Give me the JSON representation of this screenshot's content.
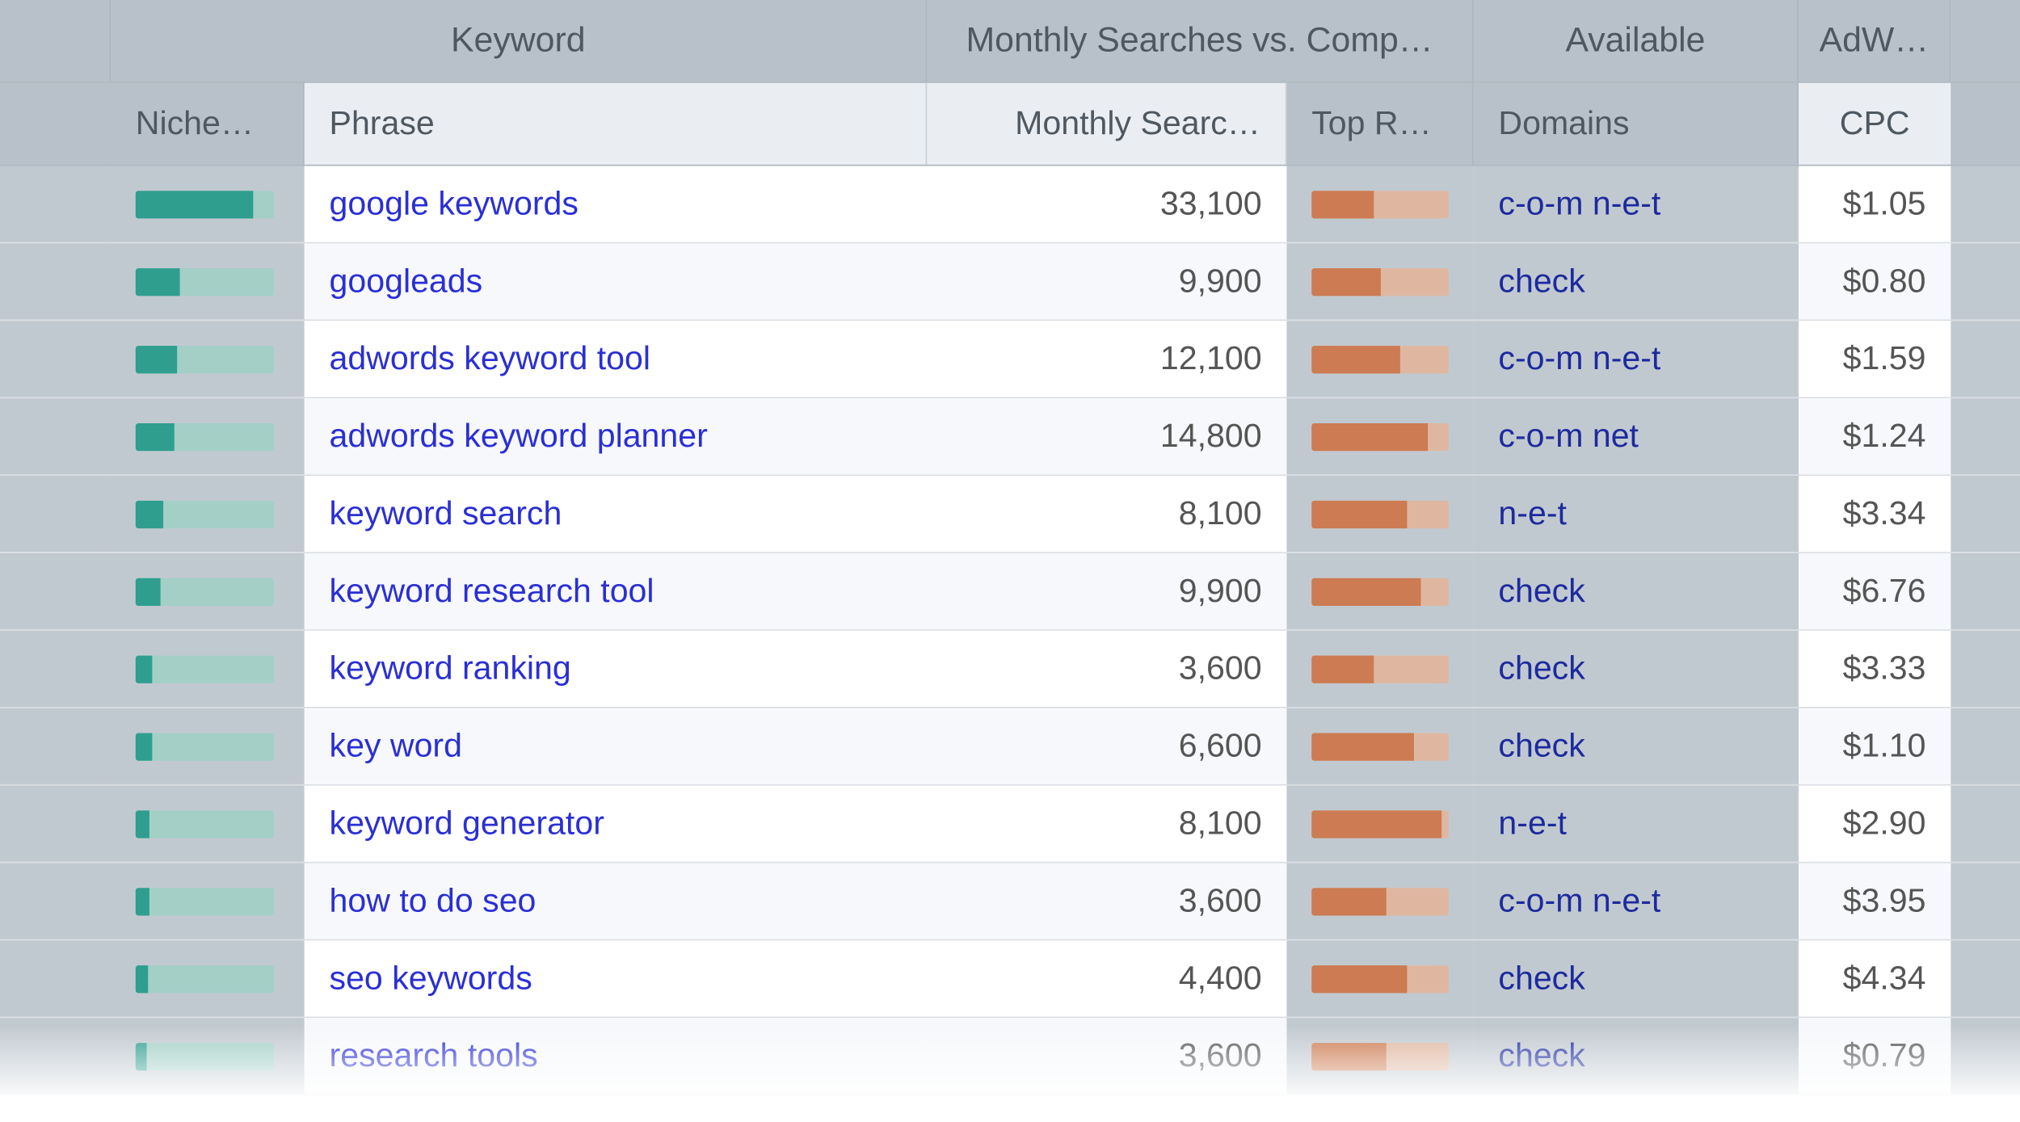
{
  "group_headers": {
    "keyword": "Keyword",
    "monthly_vs_comp": "Monthly Searches vs. Comp…",
    "available": "Available",
    "adwords": "AdW…"
  },
  "sub_headers": {
    "niche": "Niche…",
    "phrase": "Phrase",
    "monthly_searches": "Monthly Searc…",
    "top_results": "Top Re…",
    "domains": "Domains",
    "cpc": "CPC"
  },
  "rows": [
    {
      "niche_pct": 85,
      "phrase": "google keywords",
      "searches": "33,100",
      "top_pct": 45,
      "domains": "c-o-m n-e-t",
      "cpc": "$1.05"
    },
    {
      "niche_pct": 32,
      "phrase": "googleads",
      "searches": "9,900",
      "top_pct": 50,
      "domains": "check",
      "cpc": "$0.80"
    },
    {
      "niche_pct": 30,
      "phrase": "adwords keyword tool",
      "searches": "12,100",
      "top_pct": 65,
      "domains": "c-o-m n-e-t",
      "cpc": "$1.59"
    },
    {
      "niche_pct": 28,
      "phrase": "adwords keyword planner",
      "searches": "14,800",
      "top_pct": 85,
      "domains": "c-o-m net",
      "cpc": "$1.24"
    },
    {
      "niche_pct": 20,
      "phrase": "keyword search",
      "searches": "8,100",
      "top_pct": 70,
      "domains": "n-e-t",
      "cpc": "$3.34"
    },
    {
      "niche_pct": 18,
      "phrase": "keyword research tool",
      "searches": "9,900",
      "top_pct": 80,
      "domains": "check",
      "cpc": "$6.76"
    },
    {
      "niche_pct": 12,
      "phrase": "keyword ranking",
      "searches": "3,600",
      "top_pct": 45,
      "domains": "check",
      "cpc": "$3.33"
    },
    {
      "niche_pct": 12,
      "phrase": "key word",
      "searches": "6,600",
      "top_pct": 75,
      "domains": "check",
      "cpc": "$1.10"
    },
    {
      "niche_pct": 10,
      "phrase": "keyword generator",
      "searches": "8,100",
      "top_pct": 95,
      "domains": "n-e-t",
      "cpc": "$2.90"
    },
    {
      "niche_pct": 10,
      "phrase": "how to do seo",
      "searches": "3,600",
      "top_pct": 55,
      "domains": "c-o-m n-e-t",
      "cpc": "$3.95"
    },
    {
      "niche_pct": 9,
      "phrase": "seo keywords",
      "searches": "4,400",
      "top_pct": 70,
      "domains": "check",
      "cpc": "$4.34"
    },
    {
      "niche_pct": 8,
      "phrase": "research tools",
      "searches": "3,600",
      "top_pct": 55,
      "domains": "check",
      "cpc": "$0.79"
    }
  ],
  "colors": {
    "niche_fill": "#2f9e8f",
    "niche_bg": "#a3cfc7",
    "top_fill": "#cc7b52",
    "top_bg": "#dfb7a0",
    "link": "#2a2fd4",
    "domain_link": "#1d2a9e"
  }
}
